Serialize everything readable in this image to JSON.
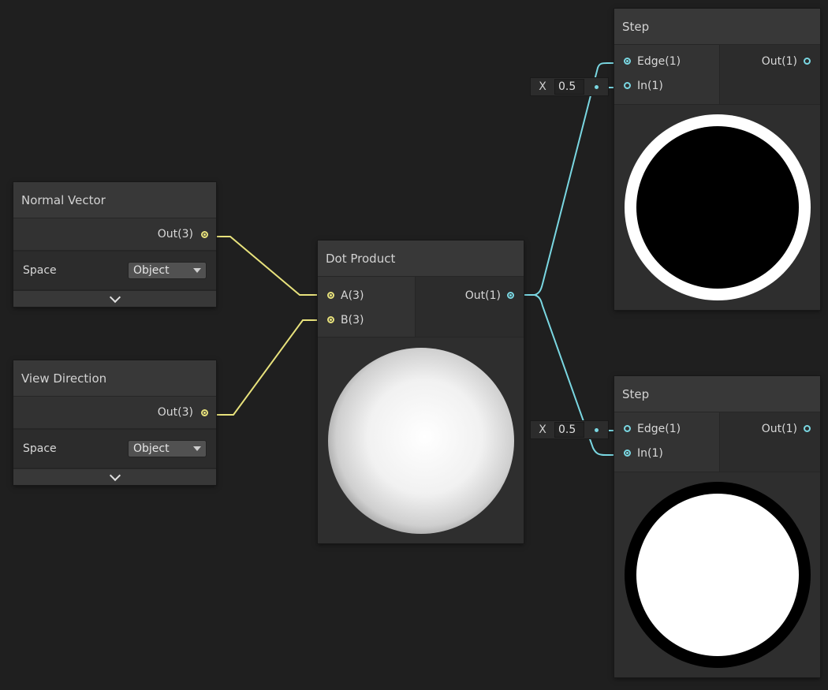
{
  "colors": {
    "background": "#1f1f1f",
    "vector3_wire": "#e8e27c",
    "float_wire": "#7ad7e2"
  },
  "nodes": {
    "normal_vector": {
      "title": "Normal Vector",
      "output_label": "Out(3)",
      "space_label": "Space",
      "space_value": "Object",
      "expand_icon": "chevron-down-icon"
    },
    "view_direction": {
      "title": "View Direction",
      "output_label": "Out(3)",
      "space_label": "Space",
      "space_value": "Object",
      "expand_icon": "chevron-down-icon"
    },
    "dot_product": {
      "title": "Dot Product",
      "inputs": [
        "A(3)",
        "B(3)"
      ],
      "output_label": "Out(1)",
      "preview": "shaded sphere"
    },
    "step_top": {
      "title": "Step",
      "inputs": [
        "Edge(1)",
        "In(1)"
      ],
      "output_label": "Out(1)",
      "inline_input": {
        "label": "X",
        "value": "0.5"
      },
      "preview": "white ring, black center"
    },
    "step_bottom": {
      "title": "Step",
      "inputs": [
        "Edge(1)",
        "In(1)"
      ],
      "output_label": "Out(1)",
      "inline_input": {
        "label": "X",
        "value": "0.5"
      },
      "preview": "black ring, white center"
    }
  }
}
